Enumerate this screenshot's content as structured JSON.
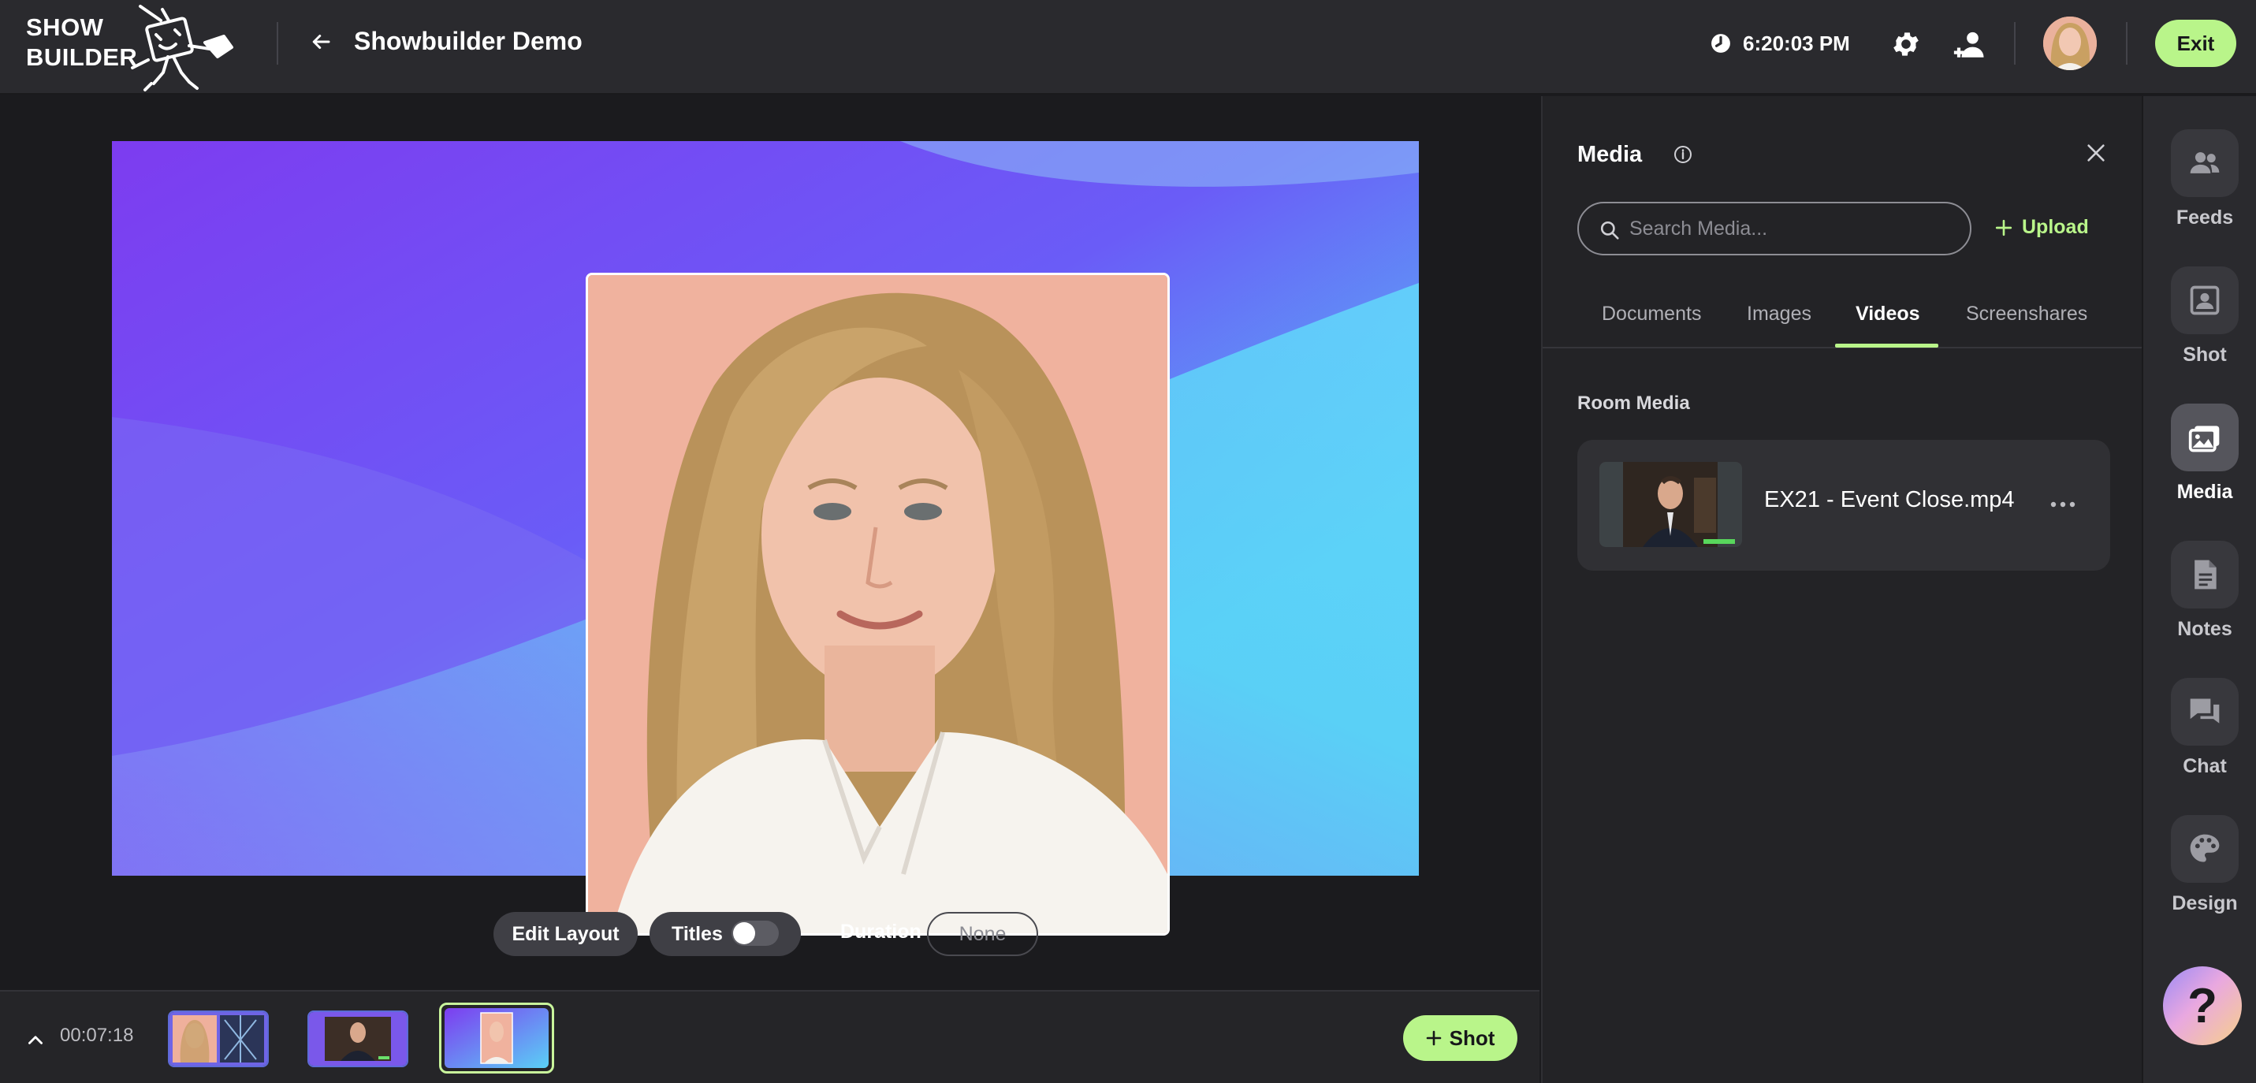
{
  "app": {
    "logo_line1": "SHOW",
    "logo_line2": "BUILDER",
    "title": "Showbuilder Demo",
    "time": "6:20:03 PM",
    "exit_label": "Exit"
  },
  "stage": {
    "edit_layout_label": "Edit Layout",
    "titles_label": "Titles",
    "titles_toggle_on": false,
    "duration_label": "Duration",
    "duration_value": "None"
  },
  "timeline": {
    "elapsed": "00:07:18",
    "shot_label": "Shot",
    "thumbnails": [
      "shot-1",
      "shot-2",
      "shot-3"
    ],
    "selected_index": 2
  },
  "media_panel": {
    "title": "Media",
    "search_placeholder": "Search Media...",
    "upload_label": "Upload",
    "tabs": [
      {
        "label": "Documents",
        "active": false
      },
      {
        "label": "Images",
        "active": false
      },
      {
        "label": "Videos",
        "active": true
      },
      {
        "label": "Screenshares",
        "active": false
      }
    ],
    "section_label": "Room Media",
    "items": [
      {
        "name": "EX21 - Event Close.mp4"
      }
    ]
  },
  "rail": {
    "items": [
      {
        "label": "Feeds",
        "icon": "people-icon",
        "active": false
      },
      {
        "label": "Shot",
        "icon": "shot-icon",
        "active": false
      },
      {
        "label": "Media",
        "icon": "media-icon",
        "active": true
      },
      {
        "label": "Notes",
        "icon": "notes-icon",
        "active": false
      },
      {
        "label": "Chat",
        "icon": "chat-icon",
        "active": false
      },
      {
        "label": "Design",
        "icon": "palette-icon",
        "active": false
      }
    ],
    "help_label": "?"
  },
  "colors": {
    "accent": "#b9f58a",
    "topbar": "#2a2a2e",
    "panel": "#232326",
    "background": "#1b1b1e"
  }
}
